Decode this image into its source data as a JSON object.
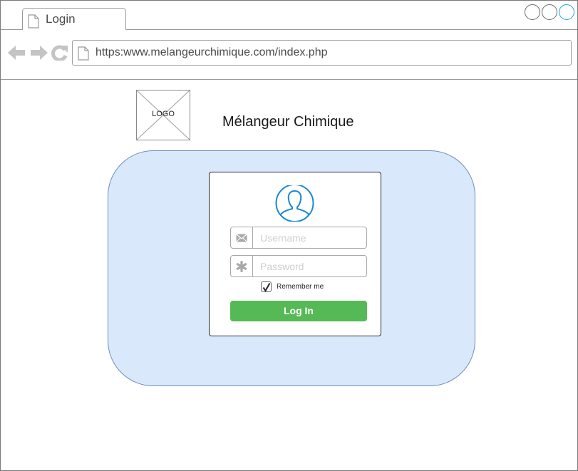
{
  "browser": {
    "tab_title": "Login",
    "url": "https:www.melangeurchimique.com/index.php",
    "window_controls": [
      "minimize",
      "maximize",
      "close"
    ]
  },
  "header": {
    "logo_text": "LOGO",
    "site_title": "Mélangeur Chimique"
  },
  "login_form": {
    "username": {
      "placeholder": "Username",
      "value": "",
      "icon": "envelope-icon"
    },
    "password": {
      "placeholder": "Password",
      "value": "",
      "icon": "asterisk-icon"
    },
    "remember_me": {
      "label": "Remember me",
      "checked": true
    },
    "submit_label": "Log In",
    "avatar_icon": "user-icon"
  },
  "colors": {
    "panel_fill": "#dae8fc",
    "panel_border": "#6c8ebf",
    "button": "#55b955",
    "avatar": "#1a88d6",
    "window_control_accent": "#1aa1e0"
  }
}
